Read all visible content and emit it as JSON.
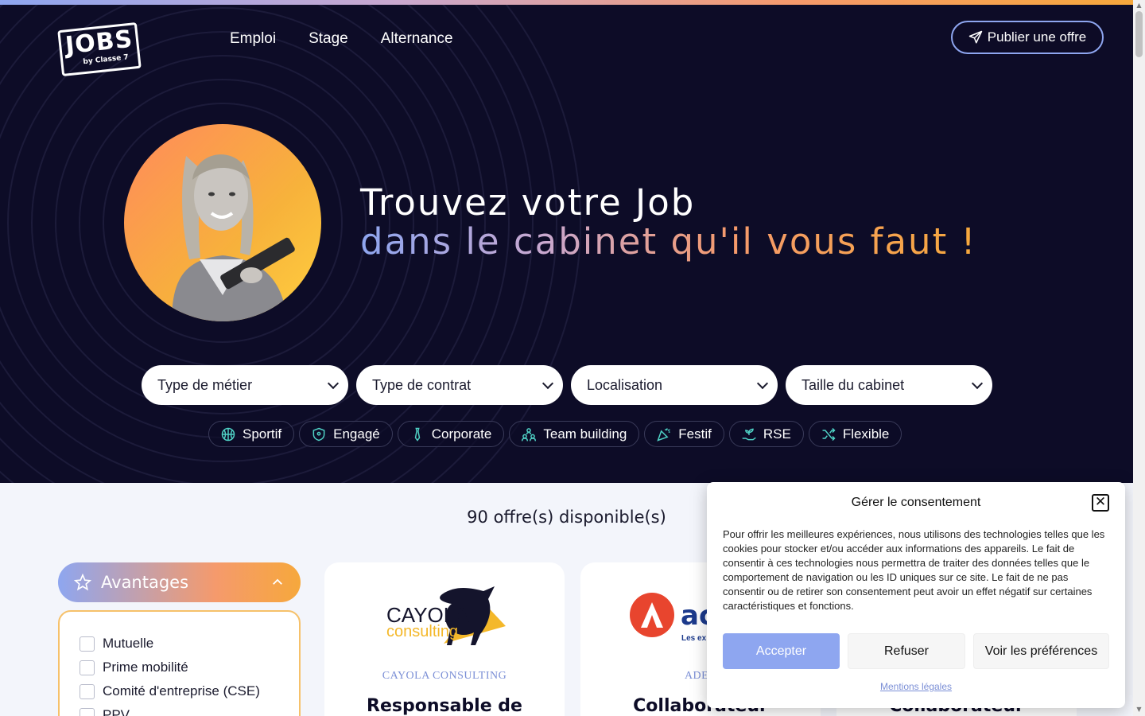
{
  "brand": {
    "logo_main": "JOBS",
    "logo_sub": "by Classe 7"
  },
  "nav": {
    "items": [
      "Emploi",
      "Stage",
      "Alternance"
    ]
  },
  "publish_button": {
    "label": "Publier une offre"
  },
  "hero": {
    "line1": "Trouvez votre Job",
    "line2": "dans le cabinet qu'il vous faut !"
  },
  "filters": [
    "Type de métier",
    "Type de contrat",
    "Localisation",
    "Taille du cabinet"
  ],
  "tags": [
    {
      "label": "Sportif",
      "icon": "basketball-icon"
    },
    {
      "label": "Engagé",
      "icon": "shield-icon"
    },
    {
      "label": "Corporate",
      "icon": "tie-icon"
    },
    {
      "label": "Team building",
      "icon": "team-icon"
    },
    {
      "label": "Festif",
      "icon": "party-popper-icon"
    },
    {
      "label": "RSE",
      "icon": "plant-hand-icon"
    },
    {
      "label": "Flexible",
      "icon": "shuffle-icon"
    }
  ],
  "offers": {
    "count_label": "90 offre(s) disponible(s)"
  },
  "advantages": {
    "title": "Avantages",
    "items": [
      "Mutuelle",
      "Prime mobilité",
      "Comité d'entreprise (CSE)",
      "PPV"
    ]
  },
  "cards": [
    {
      "company": "CAYOLA CONSULTING",
      "logo_text": "CAYOLA",
      "logo_sub": "consulting",
      "title": "Responsable de"
    },
    {
      "company": "ADEC",
      "logo_text": "ac",
      "logo_sub": "Les ex des di",
      "title": "Collaborateur"
    },
    {
      "company": "",
      "title": "Collaborateur"
    }
  ],
  "consent": {
    "title": "Gérer le consentement",
    "close_symbol": "✕",
    "text": "Pour offrir les meilleures expériences, nous utilisons des technologies telles que les cookies pour stocker et/ou accéder aux informations des appareils. Le fait de consentir à ces technologies nous permettra de traiter des données telles que le comportement de navigation ou les ID uniques sur ce site. Le fait de ne pas consentir ou de retirer son consentement peut avoir un effet négatif sur certaines caractéristiques et fonctions.",
    "accept": "Accepter",
    "refuse": "Refuser",
    "preferences": "Voir les préférences",
    "legal": "Mentions légales"
  },
  "colors": {
    "navy": "#0d0c27",
    "accent_blue": "#8ea6f0",
    "accent_orange": "#f59a6c",
    "accent_yellow": "#f6a83c"
  }
}
